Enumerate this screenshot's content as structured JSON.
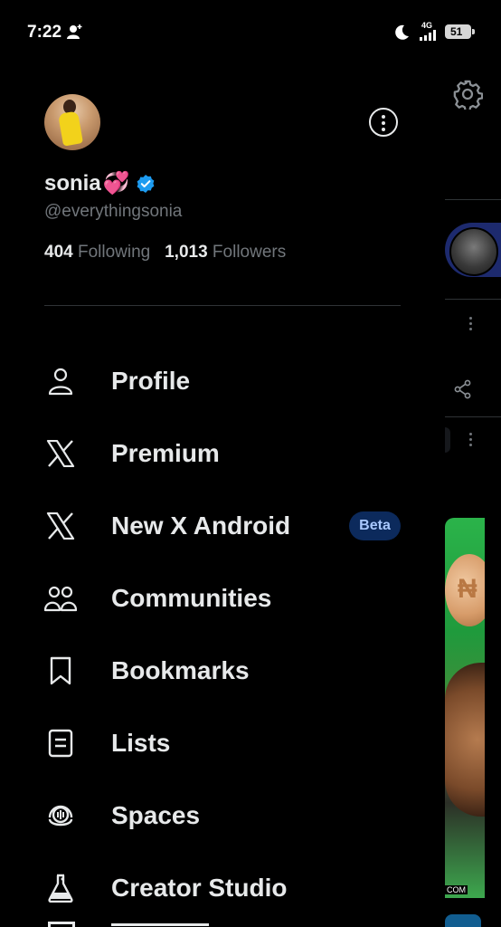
{
  "status_bar": {
    "time": "7:22",
    "network": "4G",
    "battery": "51"
  },
  "profile": {
    "display_name": "sonia",
    "name_emoji": "💞",
    "handle": "@everythingsonia",
    "following_count": "404",
    "following_label": "Following",
    "followers_count": "1,013",
    "followers_label": "Followers"
  },
  "menu": {
    "items": [
      {
        "label": "Profile",
        "icon": "person-icon"
      },
      {
        "label": "Premium",
        "icon": "x-logo-icon"
      },
      {
        "label": "New X Android",
        "icon": "x-logo-icon",
        "badge": "Beta"
      },
      {
        "label": "Communities",
        "icon": "communities-icon"
      },
      {
        "label": "Bookmarks",
        "icon": "bookmark-icon"
      },
      {
        "label": "Lists",
        "icon": "list-icon"
      },
      {
        "label": "Spaces",
        "icon": "spaces-icon"
      },
      {
        "label": "Creator Studio",
        "icon": "flask-icon"
      }
    ]
  },
  "background": {
    "com_text": "COM"
  },
  "colors": {
    "background": "#000000",
    "text": "#e7e9ea",
    "muted": "#71767b",
    "verified": "#1d9bf0",
    "beta_bg": "#0c2a5c"
  }
}
